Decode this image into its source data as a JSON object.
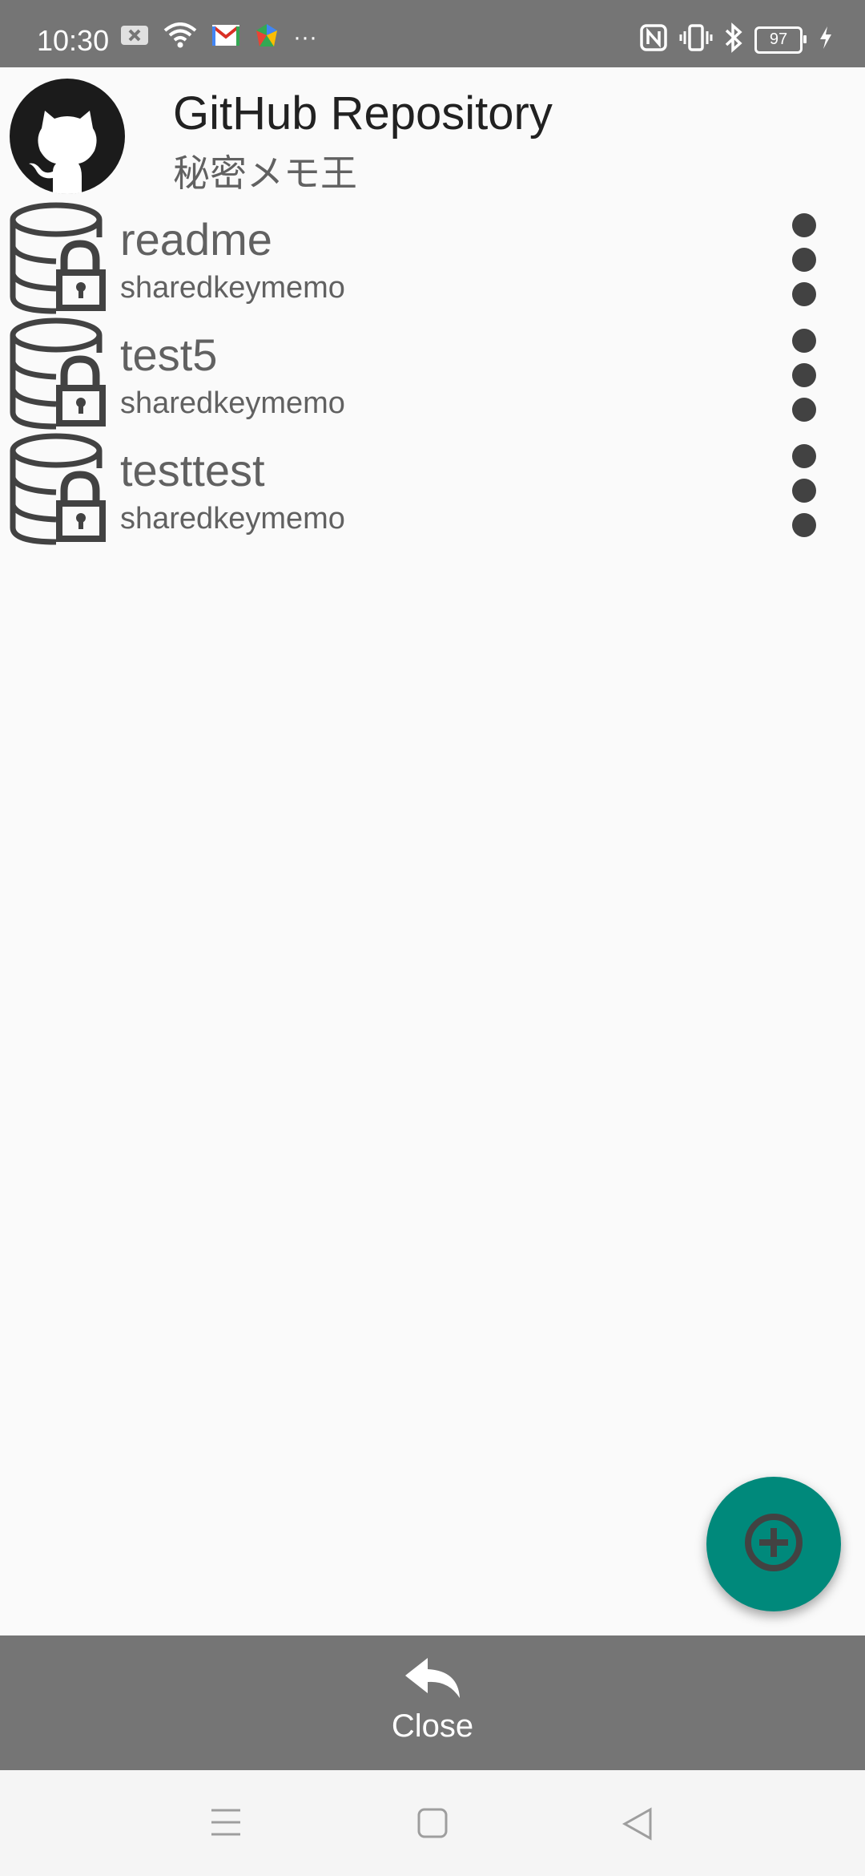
{
  "status_bar": {
    "time": "10:30",
    "battery_level": "97",
    "more_notifications": "···",
    "icons_left": [
      "notification-x-icon",
      "wifi-icon",
      "gmail-icon",
      "play-games-icon"
    ],
    "icons_right": [
      "nfc-icon",
      "vibrate-icon",
      "bluetooth-icon",
      "battery-icon",
      "charging-icon"
    ]
  },
  "header": {
    "title": "GitHub Repository",
    "subtitle": "秘密メモ王",
    "logo_icon": "github-octocat-icon"
  },
  "repositories": [
    {
      "name": "readme",
      "description": "sharedkeymemo"
    },
    {
      "name": "test5",
      "description": "sharedkeymemo"
    },
    {
      "name": "testtest",
      "description": "sharedkeymemo"
    }
  ],
  "fab": {
    "icon": "add-circle-icon",
    "color": "#00897b"
  },
  "bottom_bar": {
    "close_label": "Close",
    "close_icon": "reply-arrow-icon"
  },
  "system_nav": [
    "menu-icon",
    "home-square-icon",
    "back-triangle-icon"
  ],
  "colors": {
    "status_bar": "#757575",
    "bottom_bar": "#757575",
    "accent": "#00897b",
    "text_secondary": "#616161"
  }
}
